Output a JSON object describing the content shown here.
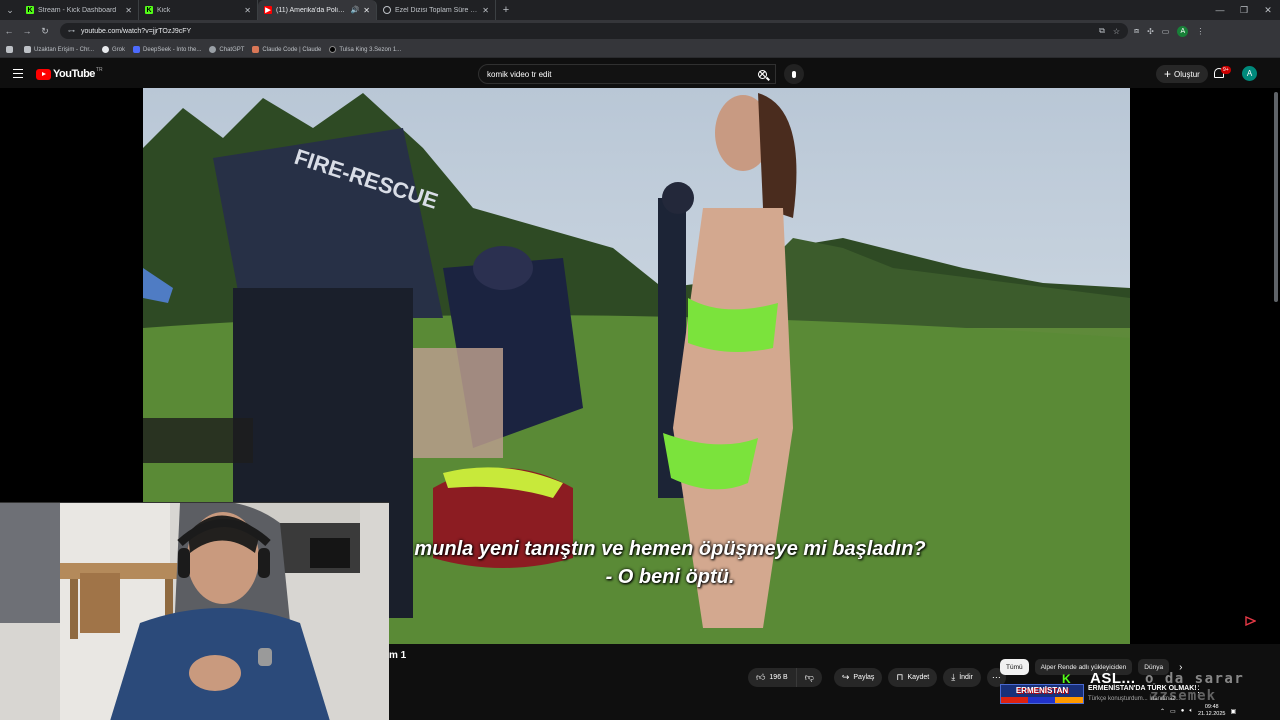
{
  "browser": {
    "tabs": [
      {
        "label": "Stream - Kick Dashboard",
        "icon": "kick-icon",
        "active": false
      },
      {
        "label": "Kick",
        "icon": "kick-icon",
        "active": false
      },
      {
        "label": "(11) Amerika'da Polisle Ge...",
        "icon": "youtube-icon",
        "active": true
      },
      {
        "label": "Ezel Dizisi Toplam Süre Tahmini",
        "icon": "globe-icon",
        "active": false
      }
    ],
    "url": "youtube.com/watch?v=jjrTOzJ9cFY",
    "bookmarks": [
      {
        "label": "",
        "icon": "apps-icon"
      },
      {
        "label": "Uzaktan Erişim - Chr...",
        "icon": "folder-icon"
      },
      {
        "label": "Grok",
        "icon": "grok-icon"
      },
      {
        "label": "DeepSeek - Into the...",
        "icon": "deepseek-icon"
      },
      {
        "label": "ChatGPT",
        "icon": "chatgpt-icon"
      },
      {
        "label": "Claude Code | Claude",
        "icon": "claude-icon"
      },
      {
        "label": "Tulsa King 3.Sezon 1...",
        "icon": "tulsa-icon"
      }
    ],
    "profile_initial": "A"
  },
  "youtube": {
    "logo_text": "YouTube",
    "logo_country": "TR",
    "search_query": "komik video tr edit",
    "create_label": "Oluştur",
    "notif_badge": "9+",
    "avatar_initial": "A"
  },
  "video": {
    "subtitle_line1": "munla yeni tanıştın ve hemen öpüşmeye mi başladın?",
    "subtitle_line2": "- O beni öptü.",
    "title_fragment": "m 1"
  },
  "actions": {
    "like_count": "196 B",
    "share_label": "Paylaş",
    "save_label": "Kaydet",
    "download_label": "İndir"
  },
  "chips": [
    {
      "label": "Tümü",
      "selected": true
    },
    {
      "label": "Alper Rende adlı yükleyiciden",
      "selected": false
    },
    {
      "label": "Dünya",
      "selected": false
    }
  ],
  "overlay": {
    "kick_mark": "K",
    "asl_text": "ASL...",
    "odasarar_text": "o da sarar",
    "zzsemek_text": "zzsemek",
    "banner_text": "ERMENİSTAN",
    "related_title": "ERMENİSTAN'DA TÜRK OLMAK!",
    "related_sub": "Türkçe konuşturdum... İnanılmaz..."
  },
  "tray": {
    "time": "09:48",
    "date": "21.12.2025"
  }
}
